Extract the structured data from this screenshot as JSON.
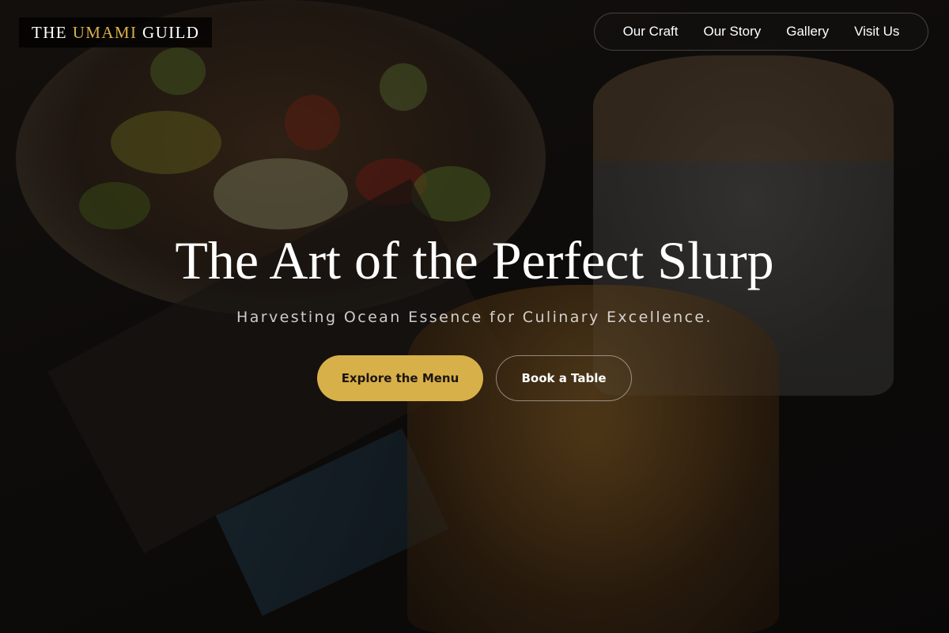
{
  "brand": {
    "prefix": "THE",
    "highlight": "UMAMI",
    "suffix": "GUILD",
    "accent_color": "#d8b049"
  },
  "nav": {
    "items": [
      {
        "label": "Our Craft"
      },
      {
        "label": "Our Story"
      },
      {
        "label": "Gallery"
      },
      {
        "label": "Visit Us"
      }
    ]
  },
  "hero": {
    "title": "The Art of the Perfect Slurp",
    "subtitle": "Harvesting Ocean Essence for Culinary Excellence.",
    "primary_cta": "Explore the Menu",
    "secondary_cta": "Book a Table",
    "background_image": "food-and-coffee-photo"
  }
}
